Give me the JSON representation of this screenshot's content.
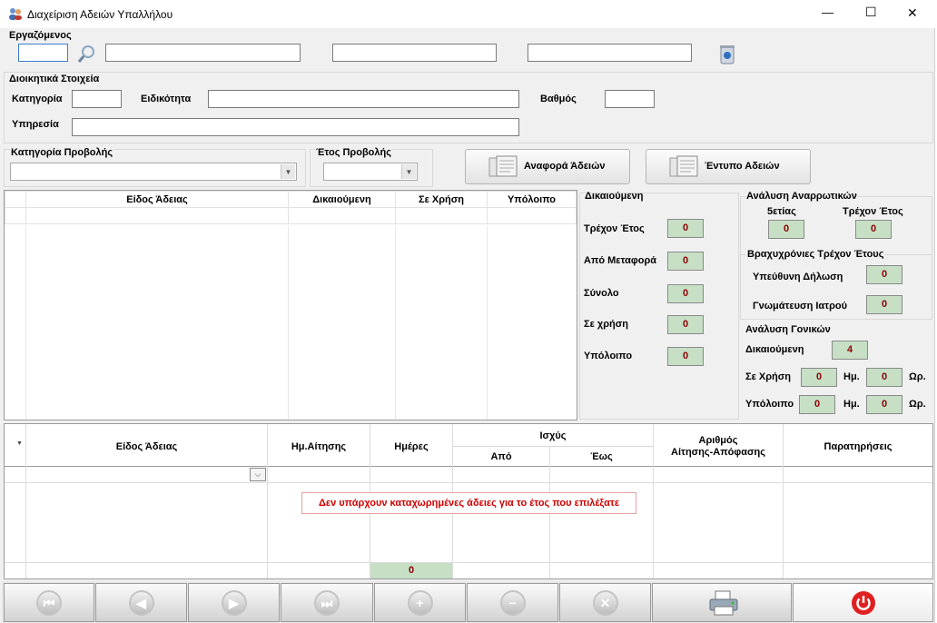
{
  "window": {
    "title": "Διαχείριση Αδειών Υπαλλήλου",
    "minimize": "—",
    "maximize": "☐",
    "close": "✕"
  },
  "employee": {
    "label": "Εργαζόμενος",
    "code": "",
    "field1": "",
    "field2": "",
    "field3": ""
  },
  "admin": {
    "label": "Διοικητικά Στοιχεία",
    "category_label": "Κατηγορία",
    "specialty_label": "Ειδικότητα",
    "grade_label": "Βαθμός",
    "service_label": "Υπηρεσία",
    "category": "",
    "specialty": "",
    "grade": "",
    "service": ""
  },
  "filters": {
    "category_view_label": "Κατηγορία Προβολής",
    "category_view_value": "",
    "year_view_label": "Έτος Προβολής",
    "year_view_value": ""
  },
  "buttons": {
    "report": "Αναφορά Άδειών",
    "form": "Έντυπο Αδειών"
  },
  "grid1": {
    "headers": [
      "Είδος Άδειας",
      "Δικαιούμενη",
      "Σε Χρήση",
      "Υπόλοιπο"
    ]
  },
  "entitled": {
    "title": "Δικαιούμενη",
    "rows": [
      {
        "label": "Τρέχον Έτος",
        "value": "0"
      },
      {
        "label": "Από Μεταφορά",
        "value": "0"
      },
      {
        "label": "Σύνολο",
        "value": "0"
      },
      {
        "label": "Σε χρήση",
        "value": "0"
      },
      {
        "label": "Υπόλοιπο",
        "value": "0"
      }
    ]
  },
  "sick": {
    "title": "Ανάλυση Αναρρωτικών",
    "col1_label": "5ετίας",
    "col1_value": "0",
    "col2_label": "Τρέχον Έτος",
    "col2_value": "0",
    "short_title": "Βραχυχρόνιες Τρέχον Έτους",
    "declaration_label": "Υπεύθυνη Δήλωση",
    "declaration_value": "0",
    "doctor_label": "Γνωμάτευση Ιατρού",
    "doctor_value": "0"
  },
  "parental": {
    "title": "Ανάλυση Γονικών",
    "entitled_label": "Δικαιούμενη",
    "entitled_value": "4",
    "used_label": "Σε Χρήση",
    "used_days": "0",
    "used_hours": "0",
    "remain_label": "Υπόλοιπο",
    "remain_days": "0",
    "remain_hours": "0",
    "days_unit": "Ημ.",
    "hours_unit": "Ωρ."
  },
  "grid2": {
    "headers": {
      "type": "Είδος Άδειας",
      "date": "Ημ.Αίτησης",
      "days": "Ημέρες",
      "validity": "Ισχύς",
      "from": "Από",
      "to": "Έως",
      "number_line1": "Αριθμός",
      "number_line2": "Αίτησης-Απόφασης",
      "notes": "Παρατηρήσεις"
    },
    "empty_message": "Δεν υπάρχουν καταχωρημένες άδειες για το έτος που επιλέξατε",
    "total_days": "0"
  },
  "colors": {
    "value_bg": "#c6dfc5",
    "value_text": "#8b0000",
    "empty_text": "#d00000",
    "power": "#e02020"
  }
}
